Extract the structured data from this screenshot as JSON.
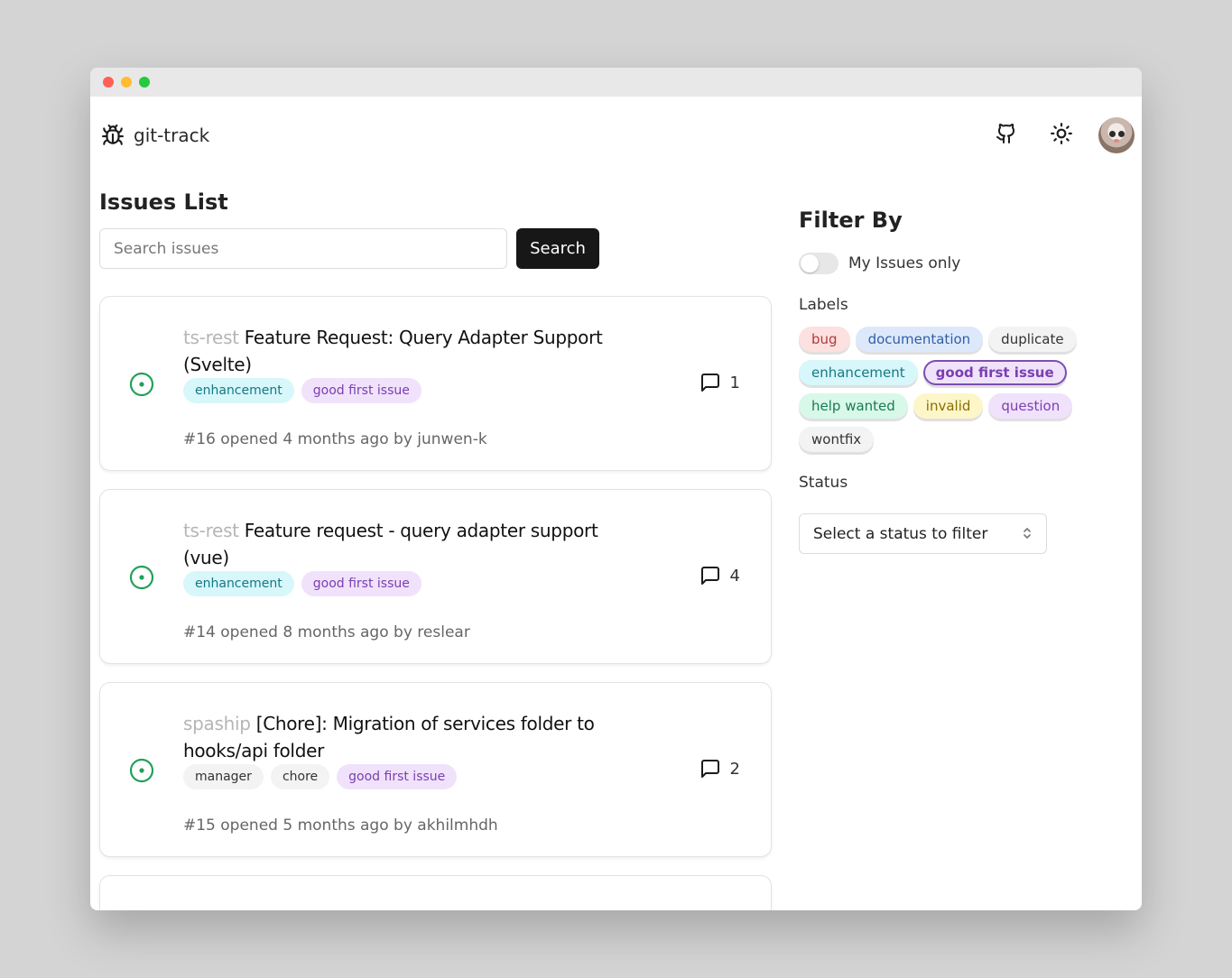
{
  "app": {
    "name": "git-track"
  },
  "main": {
    "title": "Issues List",
    "search": {
      "placeholder": "Search issues",
      "button_label": "Search"
    }
  },
  "issues": [
    {
      "repo": "ts-rest",
      "title": "Feature Request: Query Adapter Support (Svelte)",
      "labels": [
        {
          "name": "enhancement",
          "bg": "#d7f7fb",
          "fg": "#147985"
        },
        {
          "name": "good first issue",
          "bg": "#f0e2fb",
          "fg": "#7a3fb0"
        }
      ],
      "meta": "#16 opened 4 months ago by junwen-k",
      "comments": "1"
    },
    {
      "repo": "ts-rest",
      "title": "Feature request - query adapter support (vue)",
      "labels": [
        {
          "name": "enhancement",
          "bg": "#d7f7fb",
          "fg": "#147985"
        },
        {
          "name": "good first issue",
          "bg": "#f0e2fb",
          "fg": "#7a3fb0"
        }
      ],
      "meta": "#14 opened 8 months ago by reslear",
      "comments": "4"
    },
    {
      "repo": "spaship",
      "title": "[Chore]: Migration of services folder to hooks/api folder",
      "labels": [
        {
          "name": "manager",
          "bg": "#f3f3f3",
          "fg": "#333333"
        },
        {
          "name": "chore",
          "bg": "#f3f3f3",
          "fg": "#333333"
        },
        {
          "name": "good first issue",
          "bg": "#f0e2fb",
          "fg": "#7a3fb0"
        }
      ],
      "meta": "#15 opened 5 months ago by akhilmhdh",
      "comments": "2"
    }
  ],
  "filter": {
    "title": "Filter By",
    "my_issues_label": "My Issues only",
    "my_issues_on": false,
    "labels_heading": "Labels",
    "labels": [
      {
        "name": "bug",
        "bg": "#fde0e0",
        "fg": "#b33a3a",
        "active": false
      },
      {
        "name": "documentation",
        "bg": "#dde9fb",
        "fg": "#2f5fa8",
        "active": false
      },
      {
        "name": "duplicate",
        "bg": "#f3f3f3",
        "fg": "#333333",
        "active": false
      },
      {
        "name": "enhancement",
        "bg": "#d7f7fb",
        "fg": "#147985",
        "active": false
      },
      {
        "name": "good first issue",
        "bg": "#f0e2fb",
        "fg": "#7a3fb0",
        "active": true
      },
      {
        "name": "help wanted",
        "bg": "#d8f8ea",
        "fg": "#1d7a52",
        "active": false
      },
      {
        "name": "invalid",
        "bg": "#fdf6c9",
        "fg": "#8a6d00",
        "active": false
      },
      {
        "name": "question",
        "bg": "#f0e2fb",
        "fg": "#7a3fb0",
        "active": false
      },
      {
        "name": "wontfix",
        "bg": "#f3f3f3",
        "fg": "#333333",
        "active": false
      }
    ],
    "status_heading": "Status",
    "status_placeholder": "Select a status to filter"
  },
  "colors": {
    "open_status": "#22a05a",
    "primary_button": "#171717"
  },
  "icons": [
    "bug-icon",
    "github-icon",
    "sun-icon",
    "avatar",
    "issue-open-icon",
    "comment-icon",
    "chevron-updown-icon"
  ]
}
